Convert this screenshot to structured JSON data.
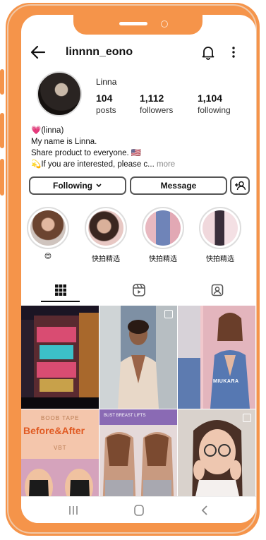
{
  "header": {
    "username": "linnnn_eono"
  },
  "profile": {
    "display_name": "Linna",
    "stats": [
      {
        "value": "104",
        "label": "posts"
      },
      {
        "value": "1,112",
        "label": "followers"
      },
      {
        "value": "1,104",
        "label": "following"
      }
    ],
    "bio": {
      "line1": "💗(linna)",
      "line2": "My name is Linna.",
      "line3": "Share product to everyone. 🇺🇸",
      "line4": "💫If you are interested, please c...",
      "more": "more"
    }
  },
  "buttons": {
    "following": "Following",
    "message": "Message"
  },
  "highlights": [
    {
      "caption": "😍"
    },
    {
      "caption": "快拍精选"
    },
    {
      "caption": "快拍精选"
    },
    {
      "caption": "快拍精选"
    }
  ],
  "grid": {
    "posts": [
      {
        "overlay_text": ""
      },
      {
        "overlay_text": ""
      },
      {
        "overlay_text": "MIUKARA"
      },
      {
        "overlay_text": "Before&After"
      },
      {
        "overlay_text": "BUST BREAST LIFTS"
      },
      {
        "overlay_text": ""
      }
    ],
    "post4_top": "BOOB TAPE",
    "post4_bottom": "VBT"
  },
  "icons": {
    "back": "back-arrow-icon",
    "bell": "bell-icon",
    "more": "more-vertical-icon",
    "grid_tab": "grid-icon",
    "reels_tab": "reels-icon",
    "tagged_tab": "tagged-icon",
    "add_user": "add-user-icon"
  }
}
